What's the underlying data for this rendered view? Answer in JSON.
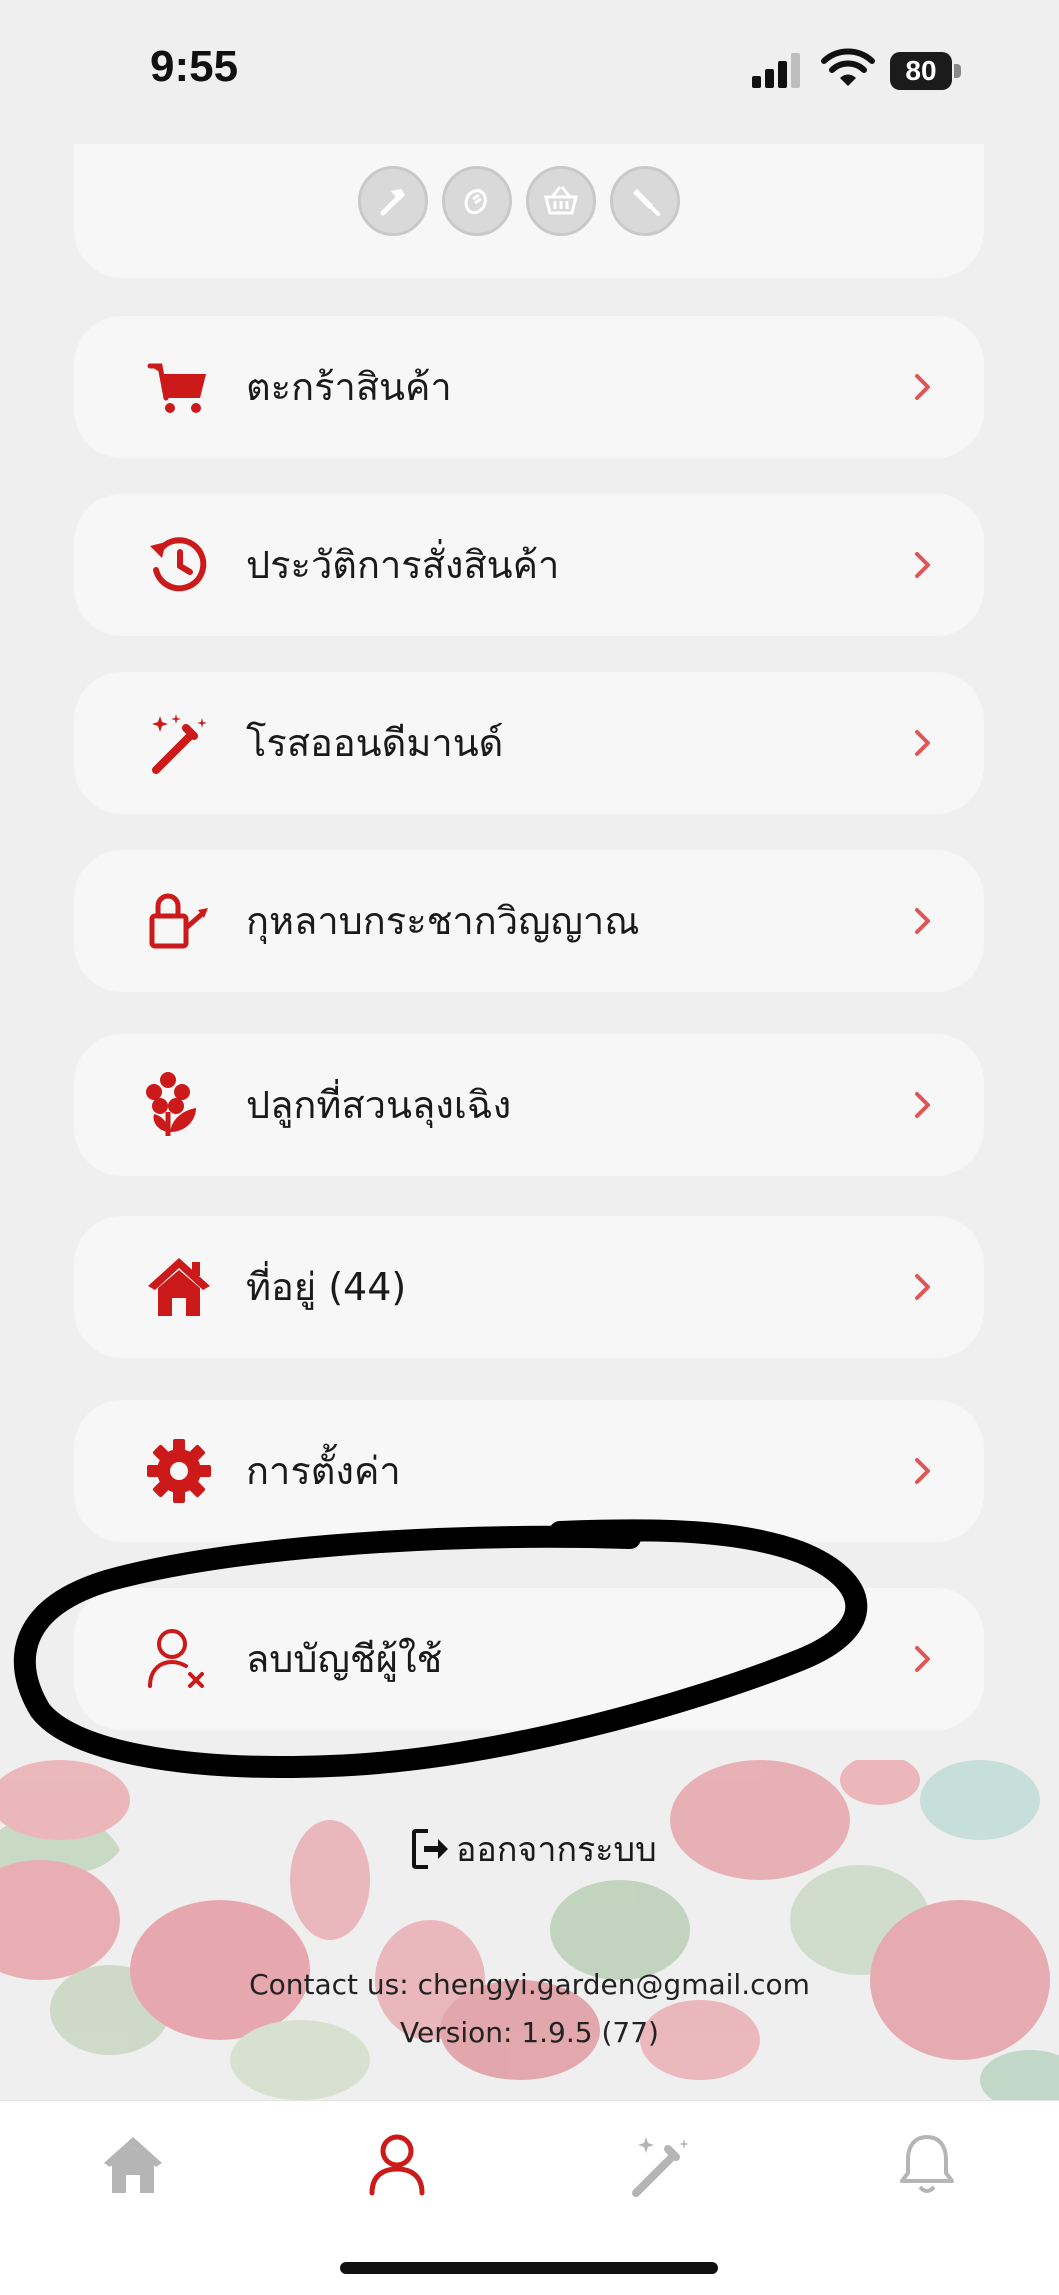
{
  "status_bar": {
    "time": "9:55",
    "battery": "80"
  },
  "top_card": {
    "icons": [
      "hammer-icon",
      "hands-icon",
      "basket-icon",
      "trowel-icon"
    ]
  },
  "menu": [
    {
      "label": "ตะกร้าสินค้า",
      "icon": "cart-icon"
    },
    {
      "label": "ประวัติการสั่งสินค้า",
      "icon": "history-icon"
    },
    {
      "label": "โรสออนดีมานด์",
      "icon": "magic-wand-icon"
    },
    {
      "label": "กุหลาบกระชากวิญญาณ",
      "icon": "watering-can-icon"
    },
    {
      "label": "ปลูกที่สวนลุงเฉิง",
      "icon": "flower-icon"
    },
    {
      "label": "ที่อยู่ (44)",
      "icon": "house-icon"
    },
    {
      "label": "การตั้งค่า",
      "icon": "gear-icon"
    },
    {
      "label": "ลบบัญชีผู้ใช้",
      "icon": "user-remove-icon"
    }
  ],
  "footer": {
    "logout_label": "ออกจากระบบ",
    "contact": "Contact us: chengyi.garden@gmail.com",
    "version": "Version: 1.9.5 (77)"
  },
  "tab_bar": {
    "tabs": [
      "home-icon",
      "profile-icon",
      "magic-wand-icon",
      "bell-icon"
    ],
    "active": "profile-icon"
  },
  "colors": {
    "accent": "#cc1a1a",
    "chevron": "#e05555",
    "background": "#efefef",
    "card": "#f7f7f7"
  }
}
